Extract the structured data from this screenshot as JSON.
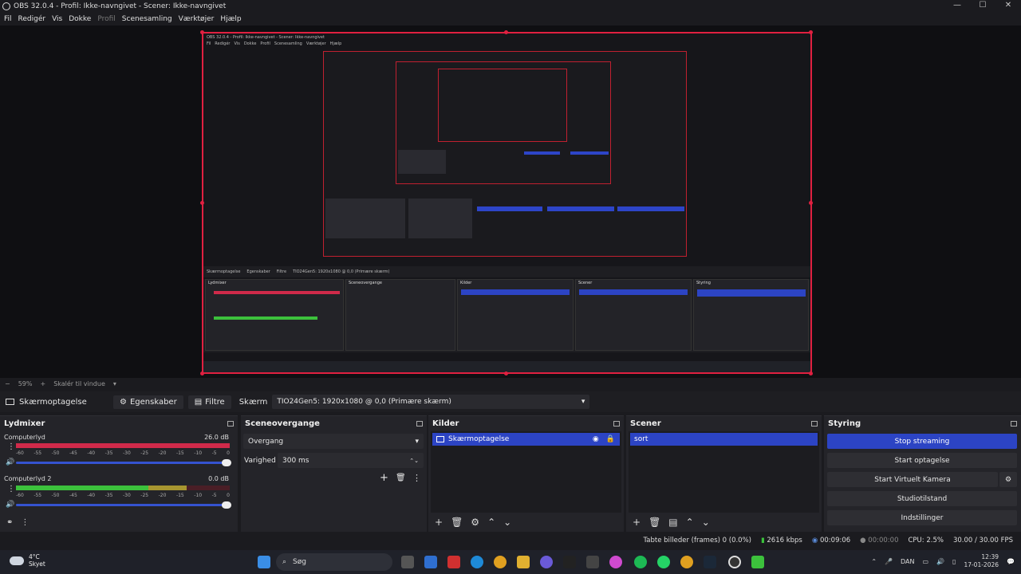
{
  "window": {
    "title": "OBS 32.0.4 - Profil: Ikke-navngivet - Scener: Ikke-navngivet",
    "minimize": "—",
    "maximize": "☐",
    "close": "✕"
  },
  "menu": [
    "Fil",
    "Redigér",
    "Vis",
    "Dokke",
    "Profil",
    "Scenesamling",
    "Værktøjer",
    "Hjælp"
  ],
  "preview": {
    "zoom": "59%",
    "scale_option": "Skalér til vindue"
  },
  "toolbar": {
    "source_name": "Skærmoptagelse",
    "properties_label": "Egenskaber",
    "filters_label": "Filtre",
    "display_label": "Skærm",
    "display_value": "TIO24Gen5: 1920x1080 @ 0,0 (Primære skærm)"
  },
  "mixer": {
    "title": "Lydmixer",
    "ticks": [
      "-60",
      "-55",
      "-50",
      "-45",
      "-40",
      "-35",
      "-30",
      "-25",
      "-20",
      "-15",
      "-10",
      "-5",
      "0"
    ],
    "channels": [
      {
        "name": "Computerlyd",
        "db": "26.0 dB",
        "level": 1.0
      },
      {
        "name": "Computerlyd 2",
        "db": "0.0 dB",
        "level": 0.8
      }
    ]
  },
  "transitions": {
    "title": "Sceneovergange",
    "transition": "Overgang",
    "duration_label": "Varighed",
    "duration_value": "300 ms"
  },
  "sources": {
    "title": "Kilder",
    "items": [
      "Skærmoptagelse"
    ]
  },
  "scenes": {
    "title": "Scener",
    "items": [
      "sort"
    ]
  },
  "controls": {
    "title": "Styring",
    "stop_streaming": "Stop streaming",
    "start_recording": "Start optagelse",
    "start_virtual_cam": "Start Virtuelt Kamera",
    "studio_mode": "Studiotilstand",
    "settings": "Indstillinger"
  },
  "status": {
    "dropped": "Tabte billeder (frames) 0 (0.0%)",
    "bitrate": "2616 kbps",
    "stream_time": "00:09:06",
    "rec_time": "00:00:00",
    "cpu": "CPU: 2.5%",
    "fps": "30.00 / 30.00 FPS"
  },
  "taskbar": {
    "temp": "4°C",
    "weather": "Skyet",
    "search": "Søg",
    "lang": "DAN",
    "time": "12:39",
    "date": "17-01-2026"
  },
  "colors": {
    "accent": "#2c44c4",
    "selection_red": "#e02040",
    "meter_green": "#3cc13c",
    "meter_yellow": "#c8b23a",
    "meter_red": "#d02a4a"
  }
}
